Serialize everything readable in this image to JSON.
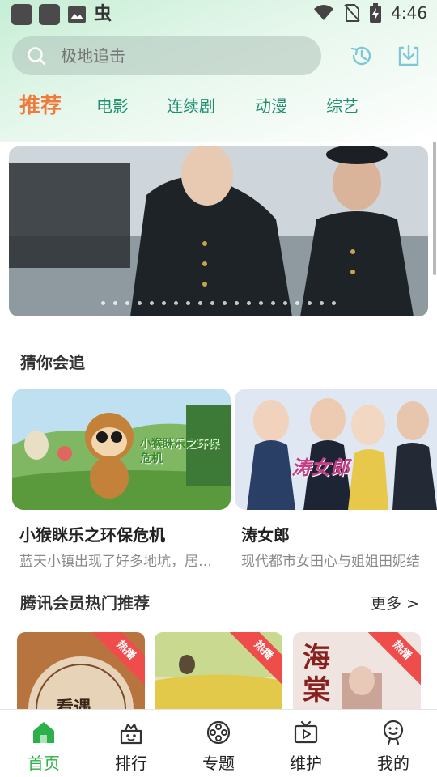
{
  "status_bar": {
    "time": "4:46",
    "left_icons": [
      "app-square-icon",
      "app-square-icon",
      "image-icon",
      "bug-icon"
    ],
    "bug_glyph": "虫",
    "right_icons": [
      "wifi-icon",
      "no-sim-icon",
      "battery-charging-icon"
    ]
  },
  "search": {
    "placeholder": "极地追击",
    "history_icon": "history-icon",
    "download_icon": "download-icon"
  },
  "tabs": [
    {
      "label": "推荐",
      "active": true
    },
    {
      "label": "电影",
      "active": false
    },
    {
      "label": "连续剧",
      "active": false
    },
    {
      "label": "动漫",
      "active": false
    },
    {
      "label": "综艺",
      "active": false
    }
  ],
  "banner": {
    "dot_count": 20
  },
  "guess": {
    "title": "猜你会追",
    "items": [
      {
        "title": "小猴眯乐之环保危机",
        "desc": "蓝天小镇出现了好多地坑，居…",
        "overlay": "小猴眯乐之环保危机"
      },
      {
        "title": "涛女郎",
        "desc": "现代都市女田心与姐姐田妮结",
        "overlay": "涛女郎"
      }
    ]
  },
  "vip": {
    "title": "腾讯会员热门推荐",
    "more": "更多 >",
    "badge": "热播",
    "posters": [
      {
        "overlay": "看遇"
      },
      {
        "overlay": ""
      },
      {
        "overlay": "海棠"
      }
    ]
  },
  "nav": [
    {
      "label": "首页",
      "icon": "home-icon",
      "active": true
    },
    {
      "label": "排行",
      "icon": "ranking-icon",
      "active": false
    },
    {
      "label": "专题",
      "icon": "topic-icon",
      "active": false
    },
    {
      "label": "维护",
      "icon": "tv-icon",
      "active": false
    },
    {
      "label": "我的",
      "icon": "profile-icon",
      "active": false
    }
  ],
  "colors": {
    "accent_orange": "#f07a3c",
    "tab_green": "#1f8f6f",
    "nav_active": "#2bb04a",
    "hot_badge": "#ef4c4c"
  }
}
